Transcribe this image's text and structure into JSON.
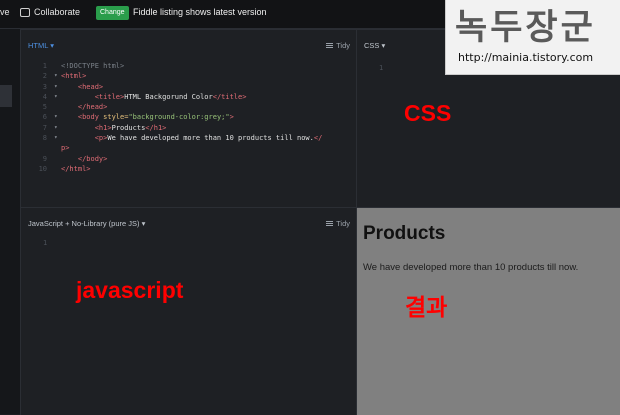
{
  "topbar": {
    "cut_label": "ve",
    "collaborate_label": "Collaborate",
    "change_button": "Change",
    "latest_status": "Fiddle listing shows latest version"
  },
  "html_pane": {
    "title": "HTML ▾",
    "tidy_label": "Tidy",
    "lines": [
      {
        "n": "1",
        "fold": "",
        "parts": [
          {
            "t": "<!DOCTYPE html>",
            "c": "comment"
          }
        ]
      },
      {
        "n": "2",
        "fold": "▾",
        "parts": [
          {
            "t": "<html>",
            "c": "tag"
          }
        ]
      },
      {
        "n": "3",
        "fold": "▾",
        "parts": [
          {
            "t": "    <head>",
            "c": "tag"
          }
        ]
      },
      {
        "n": "4",
        "fold": "▾",
        "parts": [
          {
            "t": "        <title>",
            "c": "tag"
          },
          {
            "t": "HTML Backgorund Color",
            "c": "text"
          },
          {
            "t": "</title>",
            "c": "tag"
          }
        ]
      },
      {
        "n": "5",
        "fold": "",
        "parts": [
          {
            "t": "    </head>",
            "c": "tag"
          }
        ]
      },
      {
        "n": "6",
        "fold": "▾",
        "parts": [
          {
            "t": "    <body ",
            "c": "tag"
          },
          {
            "t": "style=",
            "c": "attr"
          },
          {
            "t": "\"background-color:grey;\"",
            "c": "str"
          },
          {
            "t": ">",
            "c": "tag"
          }
        ]
      },
      {
        "n": "7",
        "fold": "▾",
        "parts": [
          {
            "t": "        <h1>",
            "c": "tag"
          },
          {
            "t": "Products",
            "c": "text"
          },
          {
            "t": "</h1>",
            "c": "tag"
          }
        ]
      },
      {
        "n": "8",
        "fold": "▾",
        "parts": [
          {
            "t": "        <p>",
            "c": "tag"
          },
          {
            "t": "We have developed more than 10 products till now.",
            "c": "text"
          },
          {
            "t": "</",
            "c": "tag"
          }
        ]
      },
      {
        "n": "",
        "fold": "",
        "parts": [
          {
            "t": "p>",
            "c": "tag"
          }
        ]
      },
      {
        "n": "9",
        "fold": "",
        "parts": [
          {
            "t": "    </body>",
            "c": "tag"
          }
        ]
      },
      {
        "n": "10",
        "fold": "",
        "parts": [
          {
            "t": "</html>",
            "c": "tag"
          }
        ]
      }
    ]
  },
  "css_pane": {
    "title": "CSS ▾",
    "line_number": "1"
  },
  "js_pane": {
    "title": "JavaScript + No-Library (pure JS) ▾",
    "tidy_label": "Tidy",
    "line_number": "1"
  },
  "result_pane": {
    "heading": "Products",
    "paragraph": "We have developed more than 10 products till now."
  },
  "overlays": {
    "css": "CSS",
    "javascript": "javascript",
    "result": "결과"
  },
  "watermark": {
    "title": "녹두장군",
    "url": "http://mainia.tistory.com"
  }
}
